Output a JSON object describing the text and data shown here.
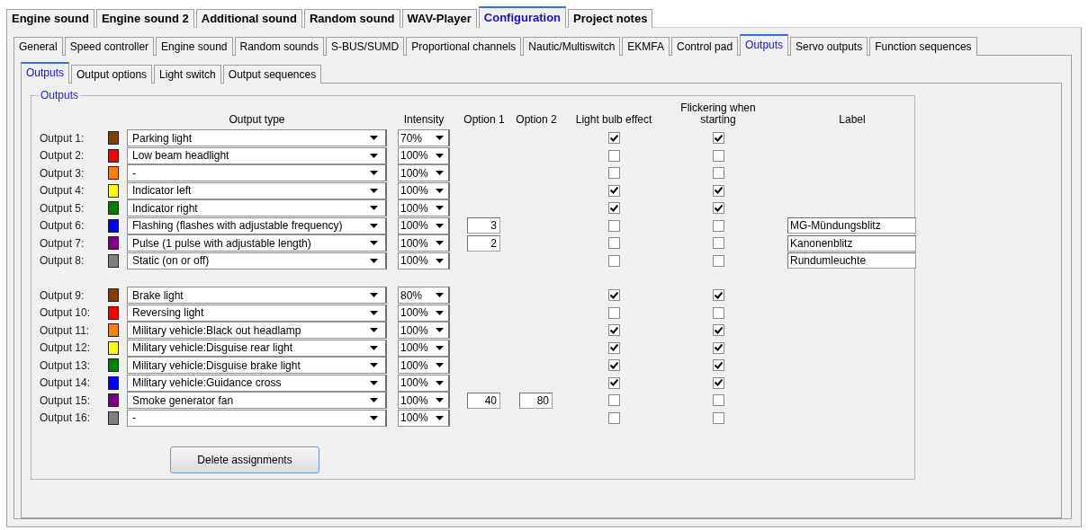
{
  "main_tabs": [
    {
      "label": "Engine sound",
      "selected": false
    },
    {
      "label": "Engine sound 2",
      "selected": false
    },
    {
      "label": "Additional sound",
      "selected": false
    },
    {
      "label": "Random sound",
      "selected": false
    },
    {
      "label": "WAV-Player",
      "selected": false
    },
    {
      "label": "Configuration",
      "selected": true
    },
    {
      "label": "Project notes",
      "selected": false
    }
  ],
  "config_tabs": [
    {
      "label": "General",
      "selected": false
    },
    {
      "label": "Speed controller",
      "selected": false
    },
    {
      "label": "Engine sound",
      "selected": false
    },
    {
      "label": "Random sounds",
      "selected": false
    },
    {
      "label": "S-BUS/SUMD",
      "selected": false
    },
    {
      "label": "Proportional channels",
      "selected": false
    },
    {
      "label": "Nautic/Multiswitch",
      "selected": false
    },
    {
      "label": "EKMFA",
      "selected": false
    },
    {
      "label": "Control pad",
      "selected": false
    },
    {
      "label": "Outputs",
      "selected": true
    },
    {
      "label": "Servo outputs",
      "selected": false
    },
    {
      "label": "Function sequences",
      "selected": false
    }
  ],
  "output_tabs": [
    {
      "label": "Outputs",
      "selected": true
    },
    {
      "label": "Output options",
      "selected": false
    },
    {
      "label": "Light switch",
      "selected": false
    },
    {
      "label": "Output sequences",
      "selected": false
    }
  ],
  "group": {
    "title": "Outputs",
    "columns": {
      "output_type": "Output type",
      "intensity": "Intensity",
      "option_1": "Option 1",
      "option_2": "Option 2",
      "light_bulb_effect": "Light bulb effect",
      "flickering": "Flickering when starting",
      "label": "Label"
    },
    "blocks": [
      {
        "rows": [
          {
            "name": "Output 1:",
            "color": "#804000",
            "type": "Parking light",
            "intensity": "70%",
            "light_bulb_effect": true,
            "flickering": true
          },
          {
            "name": "Output 2:",
            "color": "#ff0000",
            "type": "Low beam headlight",
            "intensity": "100%",
            "light_bulb_effect": false,
            "flickering": false
          },
          {
            "name": "Output 3:",
            "color": "#ff8000",
            "type": "-",
            "intensity": "100%",
            "light_bulb_effect": false,
            "flickering": false
          },
          {
            "name": "Output 4:",
            "color": "#ffff00",
            "type": "Indicator left",
            "intensity": "100%",
            "light_bulb_effect": true,
            "flickering": true
          },
          {
            "name": "Output 5:",
            "color": "#008000",
            "type": "Indicator right",
            "intensity": "100%",
            "light_bulb_effect": true,
            "flickering": true
          },
          {
            "name": "Output 6:",
            "color": "#0000ff",
            "type": "Flashing (flashes with adjustable frequency)",
            "intensity": "100%",
            "option_1": "3",
            "light_bulb_effect": false,
            "flickering": false,
            "label": "MG-Mündungsblitz"
          },
          {
            "name": "Output 7:",
            "color": "#800080",
            "type": "Pulse (1 pulse with adjustable length)",
            "intensity": "100%",
            "option_1": "2",
            "light_bulb_effect": false,
            "flickering": false,
            "label": "Kanonenblitz"
          },
          {
            "name": "Output 8:",
            "color": "#808080",
            "type": "Static (on or off)",
            "intensity": "100%",
            "light_bulb_effect": false,
            "flickering": false,
            "label": "Rundumleuchte"
          }
        ]
      },
      {
        "rows": [
          {
            "name": "Output 9:",
            "color": "#804000",
            "type": "Brake light",
            "intensity": "80%",
            "light_bulb_effect": true,
            "flickering": true
          },
          {
            "name": "Output 10:",
            "color": "#ff0000",
            "type": "Reversing light",
            "intensity": "100%",
            "light_bulb_effect": false,
            "flickering": false
          },
          {
            "name": "Output 11:",
            "color": "#ff8000",
            "type": "Military vehicle:Black out headlamp",
            "intensity": "100%",
            "light_bulb_effect": true,
            "flickering": true
          },
          {
            "name": "Output 12:",
            "color": "#ffff00",
            "type": "Military vehicle:Disguise rear light",
            "intensity": "100%",
            "light_bulb_effect": true,
            "flickering": true
          },
          {
            "name": "Output 13:",
            "color": "#008000",
            "type": "Military vehicle:Disguise brake light",
            "intensity": "100%",
            "light_bulb_effect": true,
            "flickering": true
          },
          {
            "name": "Output 14:",
            "color": "#0000ff",
            "type": "Military vehicle:Guidance cross",
            "intensity": "100%",
            "light_bulb_effect": true,
            "flickering": true
          },
          {
            "name": "Output 15:",
            "color": "#800080",
            "type": "Smoke generator fan",
            "intensity": "100%",
            "option_1": "40",
            "option_2": "80",
            "light_bulb_effect": false,
            "flickering": false
          },
          {
            "name": "Output 16:",
            "color": "#808080",
            "type": "-",
            "intensity": "100%",
            "light_bulb_effect": false,
            "flickering": false
          }
        ]
      }
    ],
    "delete_button": "Delete assignments"
  }
}
